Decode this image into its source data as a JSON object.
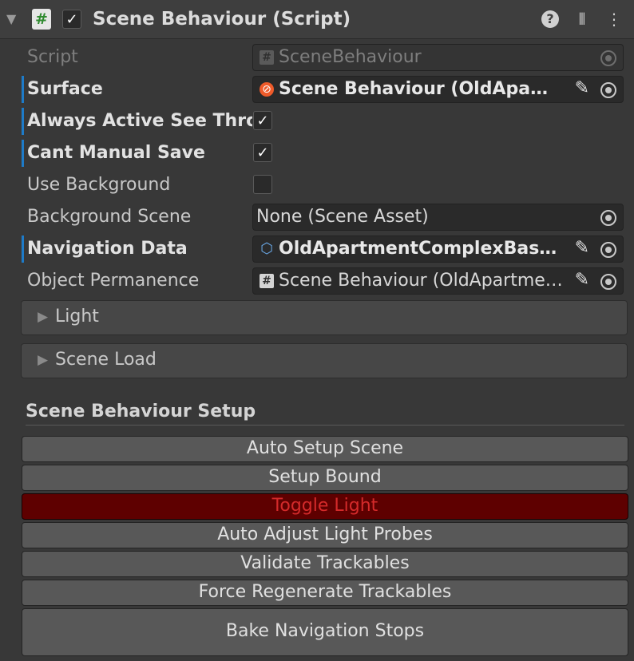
{
  "header": {
    "foldout_arrow": "▼",
    "title": "Scene Behaviour (Script)",
    "enabled": true,
    "script_icon": "hash-script-icon"
  },
  "properties": [
    {
      "label": "Script",
      "value": "SceneBehaviour",
      "icon": "hash-script-icon",
      "disabled": true
    },
    {
      "label": "Surface",
      "value": "Scene Behaviour (OldApartm…",
      "icon": "surface-icon",
      "overridden": true
    },
    {
      "label": "Always Active See Thro",
      "checked": true,
      "overridden": true
    },
    {
      "label": "Cant Manual Save",
      "checked": true,
      "overridden": true
    },
    {
      "label": "Use Background",
      "checked": false
    },
    {
      "label": "Background Scene",
      "value": "None (Scene Asset)"
    },
    {
      "label": "Navigation Data",
      "value": "OldApartmentComplexBasen…",
      "icon": "navigation-data-icon",
      "overridden": true
    },
    {
      "label": "Object Permanence",
      "value": "Scene Behaviour (OldApartme…",
      "icon": "hash-script-icon"
    }
  ],
  "foldouts": [
    {
      "label": "Light",
      "arrow": "▶"
    },
    {
      "label": "Scene Load",
      "arrow": "▶"
    }
  ],
  "setup": {
    "title": "Scene Behaviour Setup",
    "buttons": [
      "Auto Setup Scene",
      "Setup Bound",
      "Toggle Light",
      "Auto Adjust Light Probes",
      "Validate Trackables",
      "Force Regenerate Trackables",
      "Bake Navigation Stops"
    ]
  },
  "colors": {
    "override_bar": "#1e7bc8",
    "toggle_light_bg": "#5e0000",
    "toggle_light_text": "#d42a2a"
  }
}
